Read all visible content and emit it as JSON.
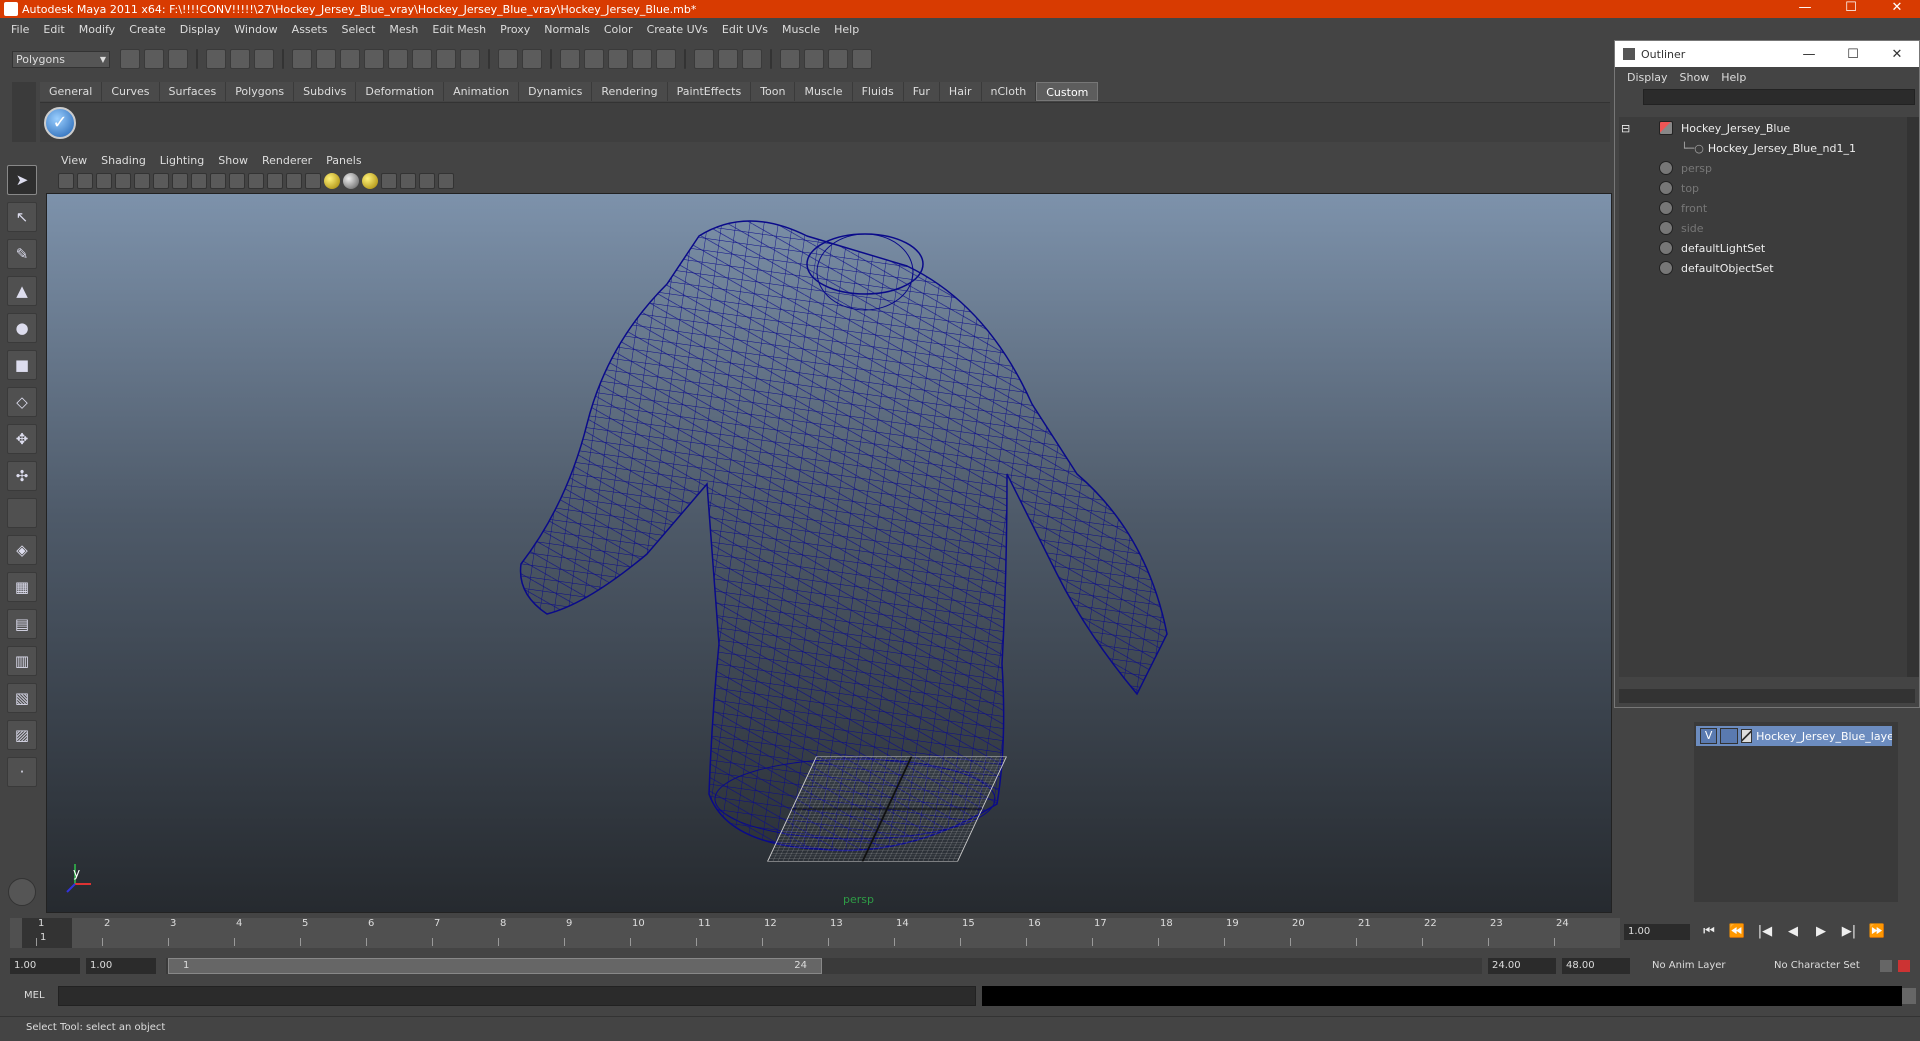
{
  "window": {
    "title": "Autodesk Maya 2011 x64: F:\\!!!!CONV!!!!!\\27\\Hockey_Jersey_Blue_vray\\Hockey_Jersey_Blue_vray\\Hockey_Jersey_Blue.mb*",
    "minimize": "—",
    "maximize": "☐",
    "close": "✕"
  },
  "menubar": [
    "File",
    "Edit",
    "Modify",
    "Create",
    "Display",
    "Window",
    "Assets",
    "Select",
    "Mesh",
    "Edit Mesh",
    "Proxy",
    "Normals",
    "Color",
    "Create UVs",
    "Edit UVs",
    "Muscle",
    "Help"
  ],
  "statusline": {
    "mode": "Polygons"
  },
  "shelf": {
    "tabs": [
      "General",
      "Curves",
      "Surfaces",
      "Polygons",
      "Subdivs",
      "Deformation",
      "Animation",
      "Dynamics",
      "Rendering",
      "PaintEffects",
      "Toon",
      "Muscle",
      "Fluids",
      "Fur",
      "Hair",
      "nCloth",
      "Custom"
    ],
    "active_tab": "Custom",
    "button_icon": "checkmark-icon"
  },
  "panel_menu": [
    "View",
    "Shading",
    "Lighting",
    "Show",
    "Renderer",
    "Panels"
  ],
  "viewport": {
    "camera": "persp",
    "axis_label": "y",
    "wire_color": "#0a0a8a"
  },
  "outliner": {
    "title": "Outliner",
    "menu": [
      "Display",
      "Show",
      "Help"
    ],
    "items": [
      {
        "label": "Hockey_Jersey_Blue",
        "icon": "mesh-transform-icon",
        "dim": false
      },
      {
        "label": "Hockey_Jersey_Blue_nd1_1",
        "icon": "",
        "dim": false
      },
      {
        "label": "persp",
        "icon": "camera-icon",
        "dim": true
      },
      {
        "label": "top",
        "icon": "camera-icon",
        "dim": true
      },
      {
        "label": "front",
        "icon": "camera-icon",
        "dim": true
      },
      {
        "label": "side",
        "icon": "camera-icon",
        "dim": true
      },
      {
        "label": "defaultLightSet",
        "icon": "set-icon",
        "dim": false
      },
      {
        "label": "defaultObjectSet",
        "icon": "set-icon",
        "dim": false
      }
    ]
  },
  "layers": {
    "visible_flag": "V",
    "name": "Hockey_Jersey_Blue_layer"
  },
  "timeline": {
    "ticks": [
      "1",
      "2",
      "3",
      "4",
      "5",
      "6",
      "7",
      "8",
      "9",
      "10",
      "11",
      "12",
      "13",
      "14",
      "15",
      "16",
      "17",
      "18",
      "19",
      "20",
      "21",
      "22",
      "23",
      "24"
    ],
    "current_frame": "1",
    "current_frame_field": "1.00",
    "playback_buttons": [
      "⏮",
      "⏪",
      "|◀",
      "◀",
      "▶",
      "▶|",
      "⏩"
    ]
  },
  "range": {
    "start": "1.00",
    "playback_start": "1.00",
    "slider_start": "1",
    "slider_end": "24",
    "playback_end": "24.00",
    "end": "48.00",
    "anim_layer": "No Anim Layer",
    "character_set": "No Character Set"
  },
  "commandline": {
    "label": "MEL"
  },
  "helpline": {
    "text": "Select Tool: select an object"
  }
}
